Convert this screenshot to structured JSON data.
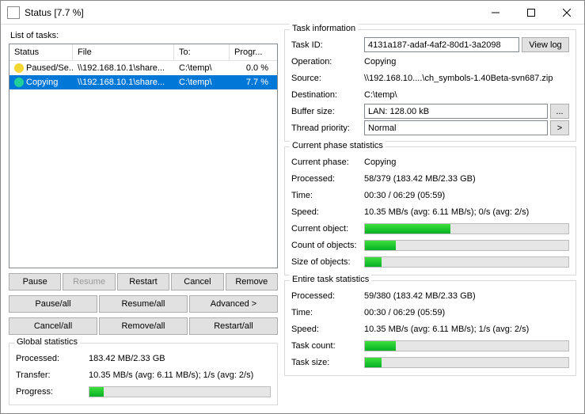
{
  "window": {
    "title": "Status [7.7 %]"
  },
  "left": {
    "list_label": "List of tasks:",
    "headers": {
      "status": "Status",
      "file": "File",
      "to": "To:",
      "prog": "Progr..."
    },
    "rows": [
      {
        "status": "Paused/Se...",
        "file": "\\\\192.168.10.1\\share...",
        "to": "C:\\temp\\",
        "prog": "0.0 %",
        "icon_color": "#f2d735"
      },
      {
        "status": "Copying",
        "file": "\\\\192.168.10.1\\share...",
        "to": "C:\\temp\\",
        "prog": "7.7 %",
        "icon_color": "#1fcf9b"
      }
    ],
    "btn_group1": {
      "pause": "Pause",
      "resume": "Resume",
      "restart": "Restart",
      "cancel": "Cancel",
      "remove": "Remove"
    },
    "btn_group2": {
      "pause_all": "Pause/all",
      "resume_all": "Resume/all",
      "advanced": "Advanced >"
    },
    "btn_group3": {
      "cancel_all": "Cancel/all",
      "remove_all": "Remove/all",
      "restart_all": "Restart/all"
    },
    "global": {
      "title": "Global statistics",
      "processed_label": "Processed:",
      "processed": "183.42 MB/2.33 GB",
      "transfer_label": "Transfer:",
      "transfer": "10.35 MB/s (avg: 6.11 MB/s); 1/s (avg: 2/s)",
      "progress_label": "Progress:",
      "progress_pct": 8
    }
  },
  "ti": {
    "title": "Task information",
    "task_id_label": "Task ID:",
    "task_id": "4131a187-adaf-4af2-80d1-3a2098",
    "view_log": "View log",
    "operation_label": "Operation:",
    "operation": "Copying",
    "source_label": "Source:",
    "source": "\\\\192.168.10....\\ch_symbols-1.40Beta-svn687.zip",
    "dest_label": "Destination:",
    "dest": "C:\\temp\\",
    "buffer_label": "Buffer size:",
    "buffer": "LAN: 128.00 kB",
    "buffer_btn": "...",
    "priority_label": "Thread priority:",
    "priority": "Normal",
    "priority_btn": ">"
  },
  "cps": {
    "title": "Current phase statistics",
    "phase_label": "Current phase:",
    "phase": "Copying",
    "processed_label": "Processed:",
    "processed": "58/379 (183.42 MB/2.33 GB)",
    "time_label": "Time:",
    "time": "00:30 / 06:29 (05:59)",
    "speed_label": "Speed:",
    "speed": "10.35 MB/s (avg: 6.11 MB/s); 0/s (avg: 2/s)",
    "curobj_label": "Current object:",
    "curobj_pct": 42,
    "count_label": "Count of objects:",
    "count_pct": 15,
    "size_label": "Size of objects:",
    "size_pct": 8
  },
  "ets": {
    "title": "Entire task statistics",
    "processed_label": "Processed:",
    "processed": "59/380 (183.42 MB/2.33 GB)",
    "time_label": "Time:",
    "time": "00:30 / 06:29 (05:59)",
    "speed_label": "Speed:",
    "speed": "10.35 MB/s (avg: 6.11 MB/s); 1/s (avg: 2/s)",
    "count_label": "Task count:",
    "count_pct": 15,
    "size_label": "Task size:",
    "size_pct": 8
  }
}
